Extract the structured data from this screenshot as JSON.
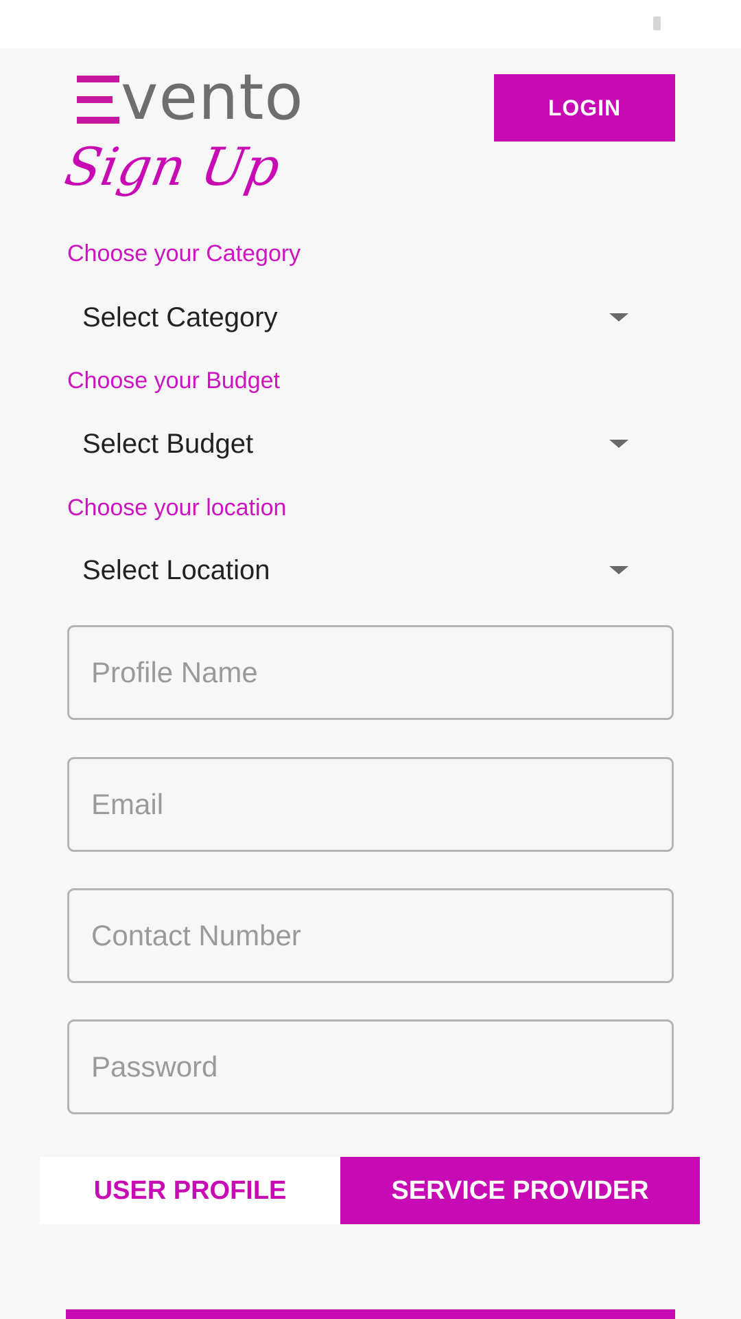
{
  "app": {
    "logo_letter": "Ξ",
    "logo_text": "vento",
    "login_label": "LOGIN",
    "signup_title": "Sign Up"
  },
  "colors": {
    "accent": "#c80ab4",
    "label": "#cc14c0",
    "background": "#f7f7f7",
    "field_border": "#b4b4b4"
  },
  "category": {
    "label": "Choose your Category",
    "selected": "Select Category"
  },
  "budget": {
    "label": "Choose your Budget",
    "selected": "Select Budget"
  },
  "location": {
    "label": "Choose your location",
    "selected": "Select Location"
  },
  "fields": {
    "profile_name_placeholder": "Profile Name",
    "email_placeholder": "Email",
    "contact_placeholder": "Contact Number",
    "password_placeholder": "Password"
  },
  "toggle": {
    "user_label": "USER PROFILE",
    "provider_label": "SERVICE PROVIDER"
  },
  "icons": {
    "dropdown": "caret-down-icon",
    "logo": "evento-logo-mark"
  }
}
